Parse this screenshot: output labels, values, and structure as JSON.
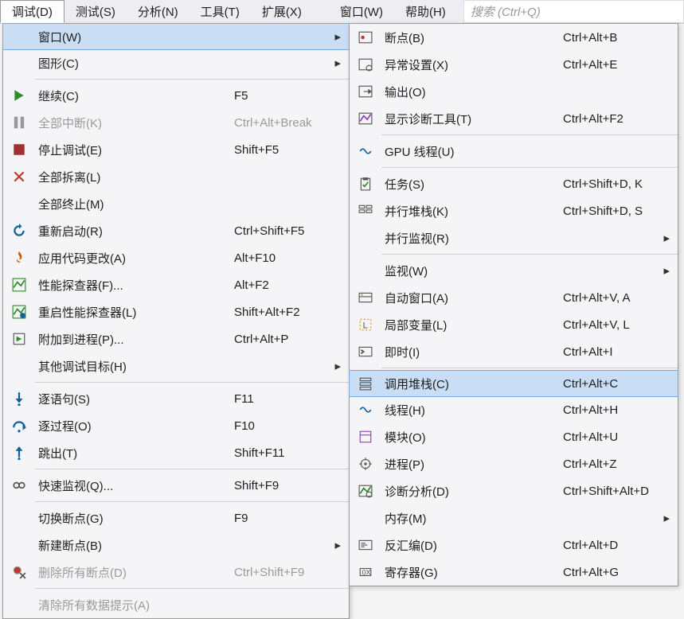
{
  "menubar": {
    "items": [
      {
        "label": "调试(D)",
        "active": true
      },
      {
        "label": "测试(S)"
      },
      {
        "label": "分析(N)"
      },
      {
        "label": "工具(T)"
      },
      {
        "label": "扩展(X)"
      },
      {
        "label": "窗口(W)"
      },
      {
        "label": "帮助(H)"
      }
    ],
    "search_placeholder": "搜索 (Ctrl+Q)"
  },
  "debug_menu": [
    {
      "type": "item",
      "icon": "",
      "label": "窗口(W)",
      "shortcut": "",
      "submenu": true,
      "highlight": true
    },
    {
      "type": "item",
      "icon": "",
      "label": "图形(C)",
      "shortcut": "",
      "submenu": true
    },
    {
      "type": "sep"
    },
    {
      "type": "item",
      "icon": "play",
      "label": "继续(C)",
      "shortcut": "F5"
    },
    {
      "type": "item",
      "icon": "pause",
      "label": "全部中断(K)",
      "shortcut": "Ctrl+Alt+Break",
      "disabled": true
    },
    {
      "type": "item",
      "icon": "stop",
      "label": "停止调试(E)",
      "shortcut": "Shift+F5"
    },
    {
      "type": "item",
      "icon": "detach",
      "label": "全部拆离(L)",
      "shortcut": ""
    },
    {
      "type": "item",
      "icon": "",
      "label": "全部终止(M)",
      "shortcut": ""
    },
    {
      "type": "item",
      "icon": "restart",
      "label": "重新启动(R)",
      "shortcut": "Ctrl+Shift+F5"
    },
    {
      "type": "item",
      "icon": "flame",
      "label": "应用代码更改(A)",
      "shortcut": "Alt+F10"
    },
    {
      "type": "item",
      "icon": "profiler",
      "label": "性能探查器(F)...",
      "shortcut": "Alt+F2"
    },
    {
      "type": "item",
      "icon": "relaunch-profiler",
      "label": "重启性能探查器(L)",
      "shortcut": "Shift+Alt+F2"
    },
    {
      "type": "item",
      "icon": "attach",
      "label": "附加到进程(P)...",
      "shortcut": "Ctrl+Alt+P"
    },
    {
      "type": "item",
      "icon": "",
      "label": "其他调试目标(H)",
      "shortcut": "",
      "submenu": true
    },
    {
      "type": "sep"
    },
    {
      "type": "item",
      "icon": "step-into",
      "label": "逐语句(S)",
      "shortcut": "F11"
    },
    {
      "type": "item",
      "icon": "step-over",
      "label": "逐过程(O)",
      "shortcut": "F10"
    },
    {
      "type": "item",
      "icon": "step-out",
      "label": "跳出(T)",
      "shortcut": "Shift+F11"
    },
    {
      "type": "sep"
    },
    {
      "type": "item",
      "icon": "watch",
      "label": "快速监视(Q)...",
      "shortcut": "Shift+F9"
    },
    {
      "type": "sep"
    },
    {
      "type": "item",
      "icon": "",
      "label": "切换断点(G)",
      "shortcut": "F9"
    },
    {
      "type": "item",
      "icon": "",
      "label": "新建断点(B)",
      "shortcut": "",
      "submenu": true
    },
    {
      "type": "item",
      "icon": "delete-breakpoints",
      "label": "删除所有断点(D)",
      "shortcut": "Ctrl+Shift+F9",
      "disabled": true
    },
    {
      "type": "sep"
    },
    {
      "type": "item",
      "icon": "",
      "label": "清除所有数据提示(A)",
      "shortcut": "",
      "disabled": true
    }
  ],
  "windows_submenu": [
    {
      "type": "item",
      "icon": "breakpoints",
      "label": "断点(B)",
      "shortcut": "Ctrl+Alt+B"
    },
    {
      "type": "item",
      "icon": "exception-settings",
      "label": "异常设置(X)",
      "shortcut": "Ctrl+Alt+E"
    },
    {
      "type": "item",
      "icon": "output",
      "label": "输出(O)",
      "shortcut": ""
    },
    {
      "type": "item",
      "icon": "diagnostics",
      "label": "显示诊断工具(T)",
      "shortcut": "Ctrl+Alt+F2"
    },
    {
      "type": "sep"
    },
    {
      "type": "item",
      "icon": "gpu-threads",
      "label": "GPU 线程(U)",
      "shortcut": ""
    },
    {
      "type": "sep"
    },
    {
      "type": "item",
      "icon": "tasks",
      "label": "任务(S)",
      "shortcut": "Ctrl+Shift+D, K"
    },
    {
      "type": "item",
      "icon": "parallel-stacks",
      "label": "并行堆栈(K)",
      "shortcut": "Ctrl+Shift+D, S"
    },
    {
      "type": "item",
      "icon": "",
      "label": "并行监视(R)",
      "shortcut": "",
      "submenu": true
    },
    {
      "type": "sep"
    },
    {
      "type": "item",
      "icon": "",
      "label": "监视(W)",
      "shortcut": "",
      "submenu": true
    },
    {
      "type": "item",
      "icon": "autos",
      "label": "自动窗口(A)",
      "shortcut": "Ctrl+Alt+V, A"
    },
    {
      "type": "item",
      "icon": "locals",
      "label": "局部变量(L)",
      "shortcut": "Ctrl+Alt+V, L"
    },
    {
      "type": "item",
      "icon": "immediate",
      "label": "即时(I)",
      "shortcut": "Ctrl+Alt+I"
    },
    {
      "type": "sep"
    },
    {
      "type": "item",
      "icon": "call-stack",
      "label": "调用堆栈(C)",
      "shortcut": "Ctrl+Alt+C",
      "highlight": true
    },
    {
      "type": "item",
      "icon": "threads",
      "label": "线程(H)",
      "shortcut": "Ctrl+Alt+H"
    },
    {
      "type": "item",
      "icon": "modules",
      "label": "模块(O)",
      "shortcut": "Ctrl+Alt+U"
    },
    {
      "type": "item",
      "icon": "processes",
      "label": "进程(P)",
      "shortcut": "Ctrl+Alt+Z"
    },
    {
      "type": "item",
      "icon": "diag-analysis",
      "label": "诊断分析(D)",
      "shortcut": "Ctrl+Shift+Alt+D"
    },
    {
      "type": "item",
      "icon": "",
      "label": "内存(M)",
      "shortcut": "",
      "submenu": true
    },
    {
      "type": "item",
      "icon": "disassembly",
      "label": "反汇编(D)",
      "shortcut": "Ctrl+Alt+D"
    },
    {
      "type": "item",
      "icon": "registers",
      "label": "寄存器(G)",
      "shortcut": "Ctrl+Alt+G"
    }
  ]
}
